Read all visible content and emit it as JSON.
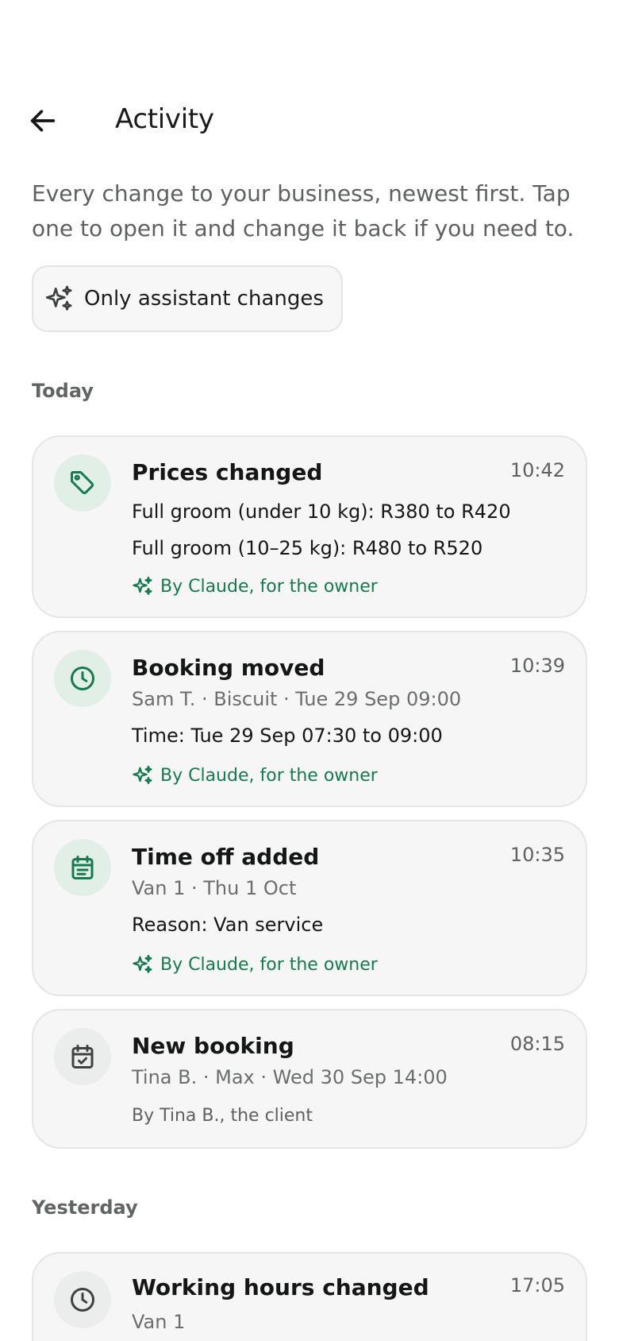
{
  "header": {
    "title": "Activity"
  },
  "intro": "Every change to your business, newest first. Tap one to open it and change it back if you need to.",
  "filter": {
    "label": "Only assistant changes"
  },
  "colors": {
    "accent": "#167a4e",
    "accent_soft": "#e1efe7",
    "card_bg": "#f5f6f5"
  },
  "sections": {
    "today": {
      "label": "Today"
    },
    "yesterday": {
      "label": "Yesterday"
    }
  },
  "entries": [
    {
      "icon": "price-tag-icon",
      "title": "Prices changed",
      "time": "10:42",
      "details": [
        "Full groom (under 10 kg): R380 to R420",
        "Full groom (10–25 kg): R480 to R520"
      ],
      "by": "By Claude, for the owner"
    },
    {
      "icon": "clock-icon",
      "title": "Booking moved",
      "time": "10:39",
      "meta": "Sam T. · Biscuit · Tue 29 Sep 09:00",
      "details": [
        "Time: Tue 29 Sep 07:30 to 09:00"
      ],
      "by": "By Claude, for the owner"
    },
    {
      "icon": "calendar-note-icon",
      "title": "Time off added",
      "time": "10:35",
      "meta": "Van 1 · Thu 1 Oct",
      "details": [
        "Reason: Van service"
      ],
      "by": "By Claude, for the owner"
    },
    {
      "icon": "calendar-check-icon",
      "title": "New booking",
      "time": "08:15",
      "meta": "Tina B. · Max · Wed 30 Sep 14:00",
      "by": "By Tina B., the client"
    },
    {
      "icon": "clock-icon",
      "title": "Working hours changed",
      "time": "17:05",
      "meta": "Van 1"
    }
  ]
}
